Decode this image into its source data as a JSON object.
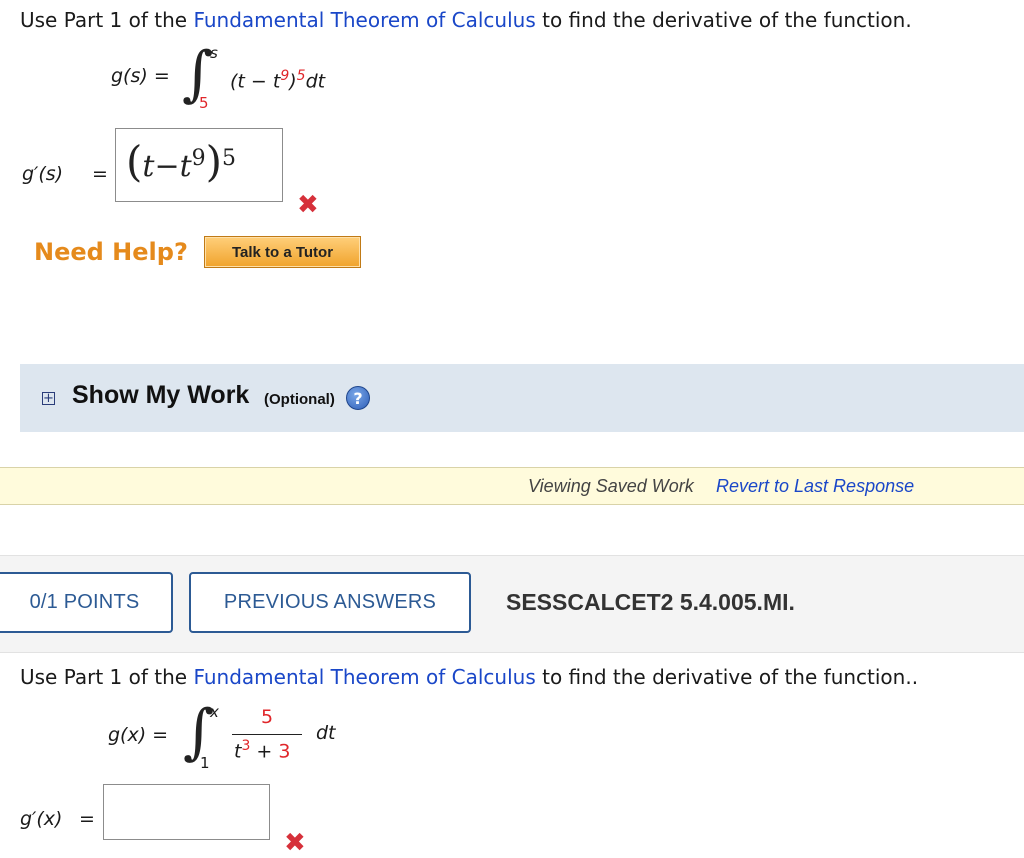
{
  "q1": {
    "prompt_pre": "Use Part 1 of the",
    "prompt_link": "Fundamental Theorem of Calculus",
    "prompt_post": "to find the derivative of the function.",
    "fn_lhs": "g(s) =",
    "upper_limit": "s",
    "lower_limit": "5",
    "integrand_pre": "(t − t",
    "integrand_exp": "9",
    "integrand_close": ")",
    "integrand_pow": "5",
    "integrand_dt": "dt",
    "answer_label": "g′(s)",
    "equals": "=",
    "answer_open": "(",
    "answer_t": "t",
    "answer_minus": "−",
    "answer_t2": "t",
    "answer_exp": "9",
    "answer_close": ")",
    "answer_pow": "5",
    "wrong_icon": "x-mark-icon"
  },
  "help": {
    "need_help": "Need Help?",
    "tutor_button": "Talk to a Tutor"
  },
  "show_work": {
    "label": "Show My Work",
    "optional": "(Optional)",
    "help_icon": "?"
  },
  "saved": {
    "viewing": "Viewing Saved Work",
    "revert": "Revert to Last Response"
  },
  "q2_header": {
    "points": "0/1 POINTS",
    "previous": "PREVIOUS ANSWERS",
    "code": "SESSCALCET2 5.4.005.MI."
  },
  "q2": {
    "prompt_pre": "Use Part 1 of the",
    "prompt_link": "Fundamental Theorem of Calculus",
    "prompt_post": "to find the derivative of the function..",
    "fn_lhs": "g(x) =",
    "upper_limit": "x",
    "lower_limit": "1",
    "numerator": "5",
    "denominator_t": "t",
    "denominator_exp": "3",
    "denominator_plus": "+",
    "denominator_const": "3",
    "dt": "dt",
    "answer_label": "g′(x)",
    "equals": "=",
    "answer_value": "",
    "wrong_icon": "x-mark-icon"
  },
  "colors": {
    "link": "#1a47c8",
    "limit_red": "#e0262a",
    "need_help": "#e58a1c",
    "panel": "#dde6ef",
    "saved_bar": "#fffbdc",
    "pill_border": "#2c5a94"
  }
}
